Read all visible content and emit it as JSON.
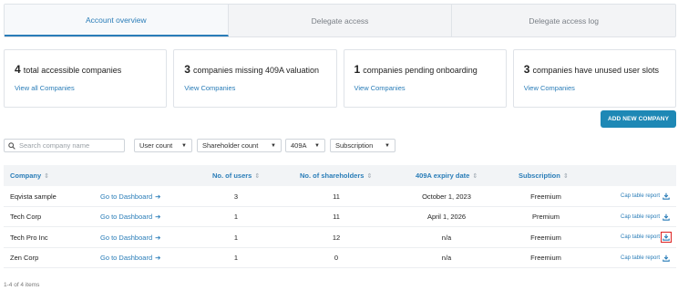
{
  "tabs": [
    {
      "label": "Account overview",
      "active": true
    },
    {
      "label": "Delegate access",
      "active": false
    },
    {
      "label": "Delegate access log",
      "active": false
    }
  ],
  "summary_cards": [
    {
      "count": "4",
      "text": "total accessible companies",
      "link": "View all Companies"
    },
    {
      "count": "3",
      "text": "companies missing 409A valuation",
      "link": "View Companies"
    },
    {
      "count": "1",
      "text": "companies pending onboarding",
      "link": "View Companies"
    },
    {
      "count": "3",
      "text": "companies have unused user slots",
      "link": "View Companies"
    }
  ],
  "add_company_label": "ADD NEW COMPANY",
  "search": {
    "placeholder": "Search company name"
  },
  "filters": [
    "User count",
    "Shareholder count",
    "409A",
    "Subscription"
  ],
  "table": {
    "headers": {
      "company": "Company",
      "users": "No. of users",
      "shareholders": "No. of shareholders",
      "expiry": "409A expiry date",
      "subscription": "Subscription"
    },
    "dashboard_link": "Go to Dashboard",
    "report_link": "Cap table report",
    "rows": [
      {
        "company": "Eqvista sample",
        "users": "3",
        "shareholders": "11",
        "expiry": "October 1, 2023",
        "subscription": "Freemium"
      },
      {
        "company": "Tech Corp",
        "users": "1",
        "shareholders": "11",
        "expiry": "April 1, 2026",
        "subscription": "Premium"
      },
      {
        "company": "Tech Pro Inc",
        "users": "1",
        "shareholders": "12",
        "expiry": "n/a",
        "subscription": "Freemium"
      },
      {
        "company": "Zen Corp",
        "users": "1",
        "shareholders": "0",
        "expiry": "n/a",
        "subscription": "Freemium"
      }
    ]
  },
  "pagination_text": "1-4 of 4 items",
  "colors": {
    "accent": "#2a7db8",
    "button": "#1e88b5",
    "highlight_box": "#dd2222"
  },
  "icons": {
    "search": "search-icon",
    "dropdown": "caret-down-icon",
    "sort": "sort-icon",
    "download": "download-icon",
    "arrow": "arrow-right-icon"
  }
}
